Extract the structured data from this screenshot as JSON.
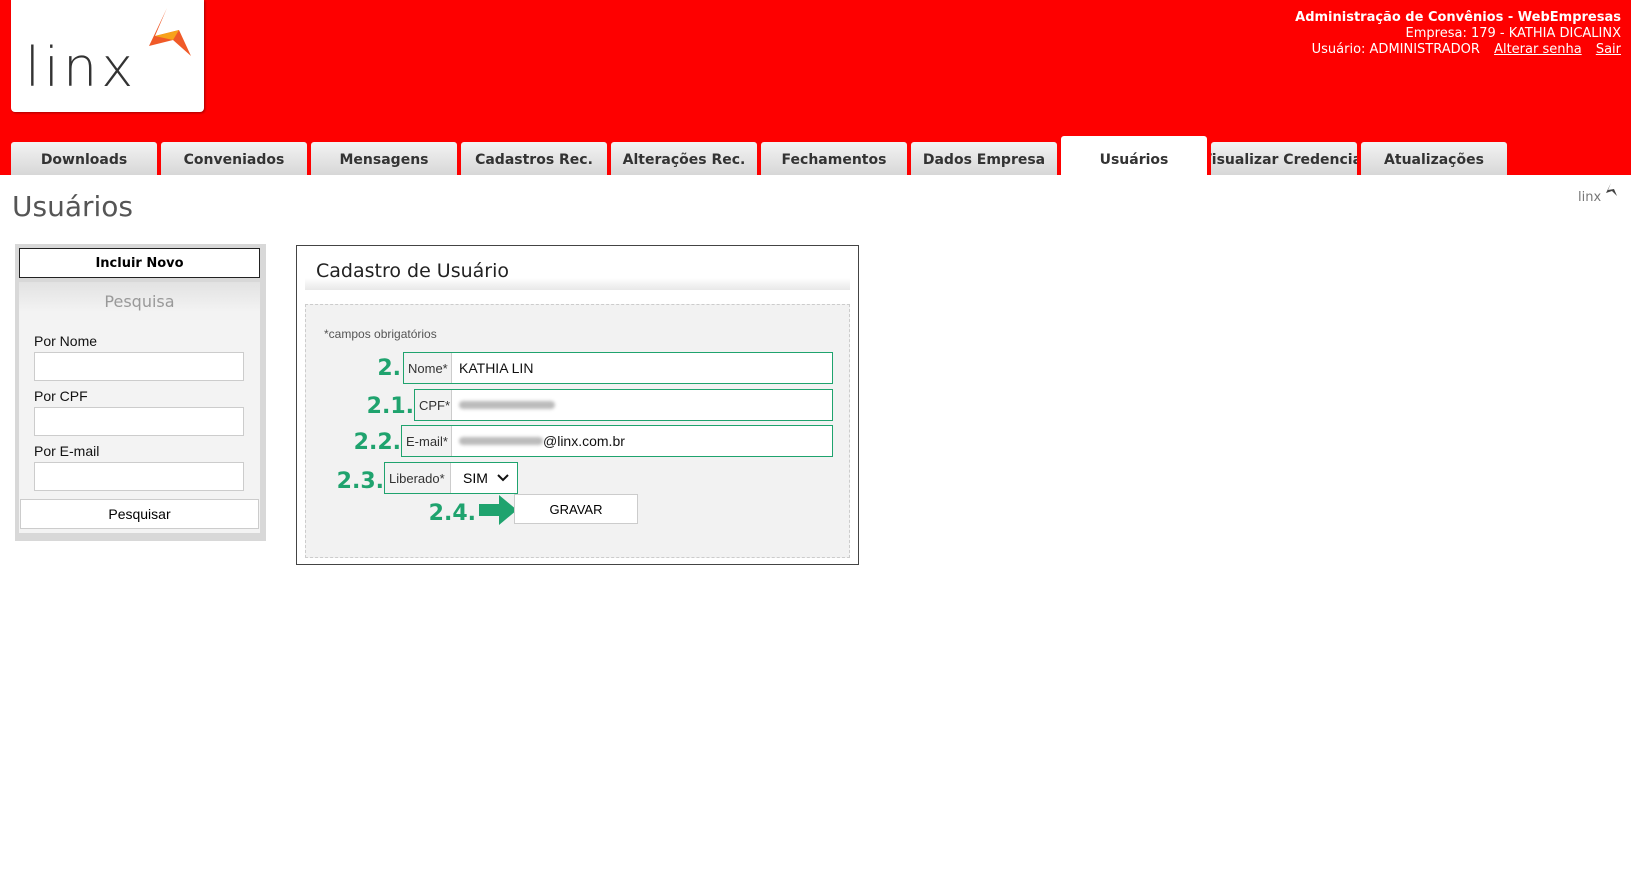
{
  "header": {
    "logo_text": "linx",
    "app_title": "Administração de Convênios - WebEmpresas",
    "company": "Empresa: 179 - KATHIA DICALINX",
    "user": "Usuário: ADMINISTRADOR",
    "change_password": "Alterar senha",
    "logout": "Sair",
    "background_color": "#fe0000"
  },
  "tabs": [
    {
      "label": "Downloads"
    },
    {
      "label": "Conveniados"
    },
    {
      "label": "Mensagens"
    },
    {
      "label": "Cadastros Rec."
    },
    {
      "label": "Alterações Rec."
    },
    {
      "label": "Fechamentos"
    },
    {
      "label": "Dados Empresa"
    },
    {
      "label": "Usuários",
      "active": true
    },
    {
      "label": "Visualizar Credencial"
    },
    {
      "label": "Atualizações"
    }
  ],
  "page": {
    "title": "Usuários",
    "small_logo_text": "linx"
  },
  "sidebar": {
    "include_new": "Incluir Novo",
    "search_title": "Pesquisa",
    "by_name": "Por Nome",
    "by_cpf": "Por CPF",
    "by_email": "Por E-mail",
    "search_button": "Pesquisar"
  },
  "form": {
    "title": "Cadastro de Usuário",
    "required_note": "*campos obrigatórios",
    "name_label": "Nome*",
    "name_value": "KATHIA LIN",
    "cpf_label": "CPF*",
    "email_label": "E-mail*",
    "email_domain": "@linx.com.br",
    "liberado_label": "Liberado*",
    "liberado_value": "SIM",
    "save_button": "GRAVAR"
  },
  "steps": {
    "s2": "2.",
    "s21": "2.1.",
    "s22": "2.2.",
    "s23": "2.3.",
    "s24": "2.4.",
    "color": "#1fa36e"
  }
}
